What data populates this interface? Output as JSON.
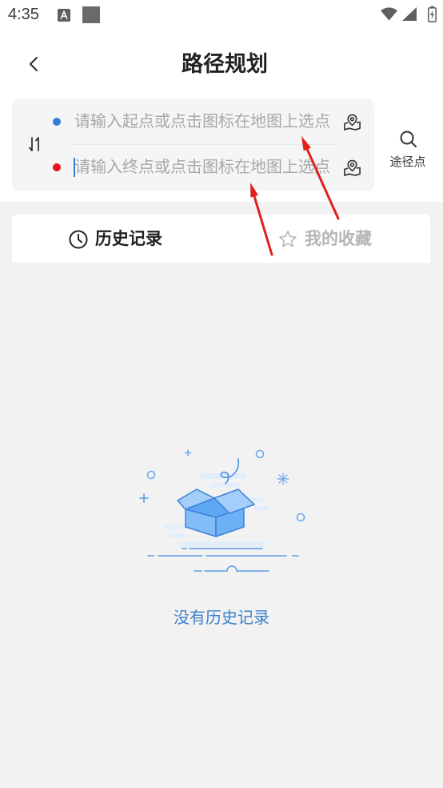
{
  "status_bar": {
    "time": "4:35",
    "left_icons": [
      "notification-a-icon",
      "notification-square-icon"
    ],
    "right_icons": [
      "wifi-icon",
      "signal-icon",
      "battery-charging-icon"
    ]
  },
  "header": {
    "back_icon": "chevron-left-icon",
    "title": "路径规划"
  },
  "route": {
    "swap_icon": "swap-vertical-icon",
    "start": {
      "value": "",
      "placeholder": "请输入起点或点击图标在地图上选点",
      "pick_icon": "map-pin-icon"
    },
    "end": {
      "value": "",
      "placeholder": "请输入终点或点击图标在地图上选点",
      "pick_icon": "map-pin-icon",
      "focused": true
    },
    "waypoint": {
      "icon": "search-icon",
      "label": "途径点"
    }
  },
  "tabs": [
    {
      "label": "历史记录",
      "icon": "clock-icon",
      "active": true
    },
    {
      "label": "我的收藏",
      "icon": "star-icon",
      "active": false
    }
  ],
  "empty_state": {
    "illustration": "open-empty-box",
    "message": "没有历史记录"
  },
  "colors": {
    "accent": "#2f7fd8",
    "start_dot": "#2f7fd8",
    "end_dot": "#e8141c",
    "annotation": "#e0201a",
    "empty_text": "#3a80cc"
  }
}
